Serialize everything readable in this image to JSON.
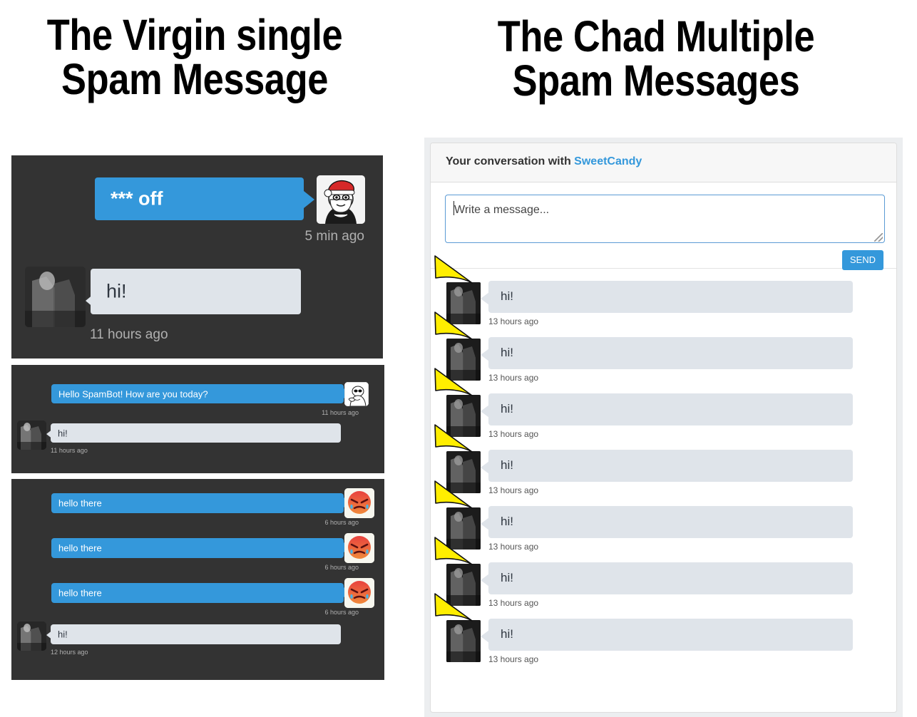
{
  "titles": {
    "left": "The Virgin single Spam Message",
    "left_line1": "The Virgin single",
    "left_line2": "Spam Message",
    "right_line1": "The Chad Multiple",
    "right_line2": "Spam Messages"
  },
  "colors": {
    "blue": "#3498db",
    "gray_bubble": "#dfe4ea",
    "dark_panel": "#333333",
    "hat_yellow": "#ffee00",
    "link_blue": "#3498db"
  },
  "left": {
    "panel1": {
      "messages": [
        {
          "side": "out",
          "text": "*** off",
          "time": "5 min ago",
          "avatar": "santa-troll-avatar"
        },
        {
          "side": "in",
          "text": "hi!",
          "time": "11 hours ago",
          "avatar": "photo-avatar"
        }
      ]
    },
    "panel2": {
      "messages": [
        {
          "side": "out",
          "text": "Hello SpamBot! How are you today?",
          "time": "11 hours ago",
          "avatar": "rage-comic-avatar"
        },
        {
          "side": "in",
          "text": "hi!",
          "time": "11 hours ago",
          "avatar": "photo-avatar"
        }
      ]
    },
    "panel3": {
      "messages": [
        {
          "side": "out",
          "text": "hello there",
          "time": "6 hours ago",
          "avatar": "angry-crying-emoji-avatar"
        },
        {
          "side": "out",
          "text": "hello there",
          "time": "6 hours ago",
          "avatar": "angry-crying-emoji-avatar"
        },
        {
          "side": "out",
          "text": "hello there",
          "time": "6 hours ago",
          "avatar": "angry-crying-emoji-avatar"
        },
        {
          "side": "in",
          "text": "hi!",
          "time": "12 hours ago",
          "avatar": "photo-avatar"
        }
      ]
    }
  },
  "right": {
    "header_prefix": "Your conversation with ",
    "header_username": "SweetCandy",
    "compose": {
      "placeholder": "Write a message...",
      "value": "",
      "send_label": "SEND"
    },
    "messages": [
      {
        "text": "hi!",
        "time": "13 hours ago",
        "avatar": "photo-avatar-with-party-hat"
      },
      {
        "text": "hi!",
        "time": "13 hours ago",
        "avatar": "photo-avatar-with-party-hat"
      },
      {
        "text": "hi!",
        "time": "13 hours ago",
        "avatar": "photo-avatar-with-party-hat"
      },
      {
        "text": "hi!",
        "time": "13 hours ago",
        "avatar": "photo-avatar-with-party-hat"
      },
      {
        "text": "hi!",
        "time": "13 hours ago",
        "avatar": "photo-avatar-with-party-hat"
      },
      {
        "text": "hi!",
        "time": "13 hours ago",
        "avatar": "photo-avatar-with-party-hat"
      },
      {
        "text": "hi!",
        "time": "13 hours ago",
        "avatar": "photo-avatar-with-party-hat"
      }
    ]
  }
}
